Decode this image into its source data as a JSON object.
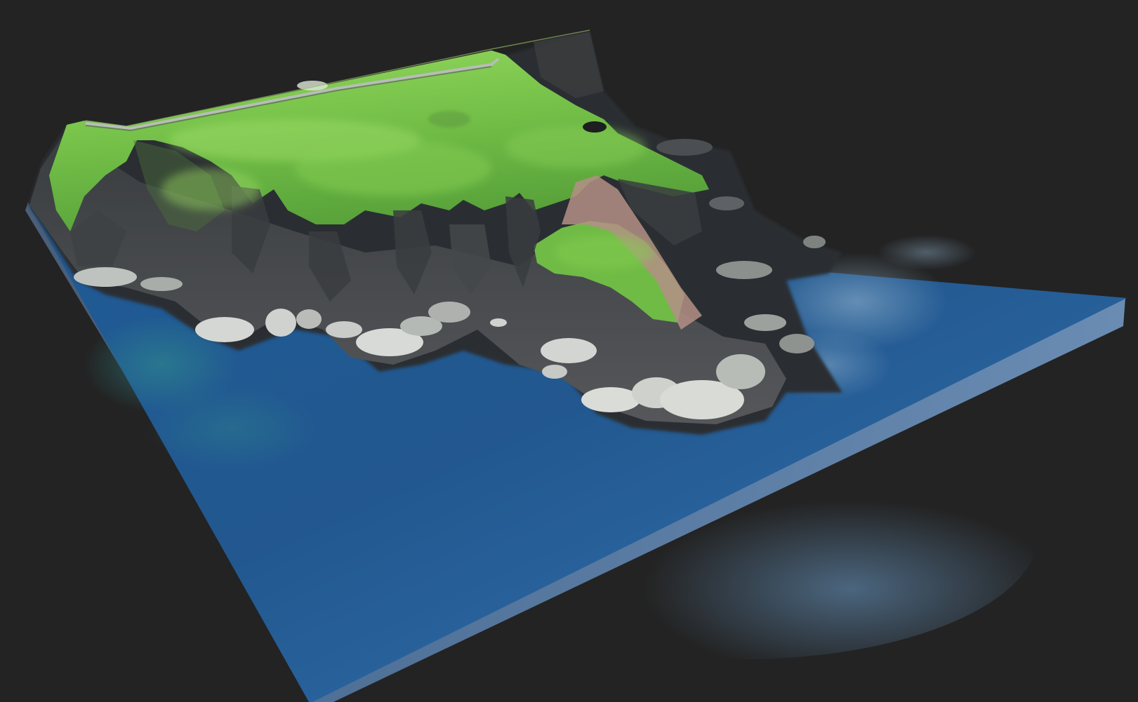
{
  "scene": {
    "subject": "coastal-headland-terrain-model",
    "background_color": "#232323",
    "colors": {
      "sea_deep": "#1a4a7e",
      "sea_mid": "#2a64a0",
      "sea_light": "#4f86b8",
      "sea_teal": "#2f8a8c",
      "slab_side": "#5c7ea6",
      "grass_light": "#8ed457",
      "grass_mid": "#5fae3c",
      "grass_dark": "#3e7f2a",
      "cliff_dark": "#2f3236",
      "cliff_mid": "#5a5b5c",
      "rock_light": "#d9dcd8",
      "rock_mid": "#a4a8a6",
      "path_pink": "#b48f86",
      "wall": "#b7bdb8"
    }
  }
}
